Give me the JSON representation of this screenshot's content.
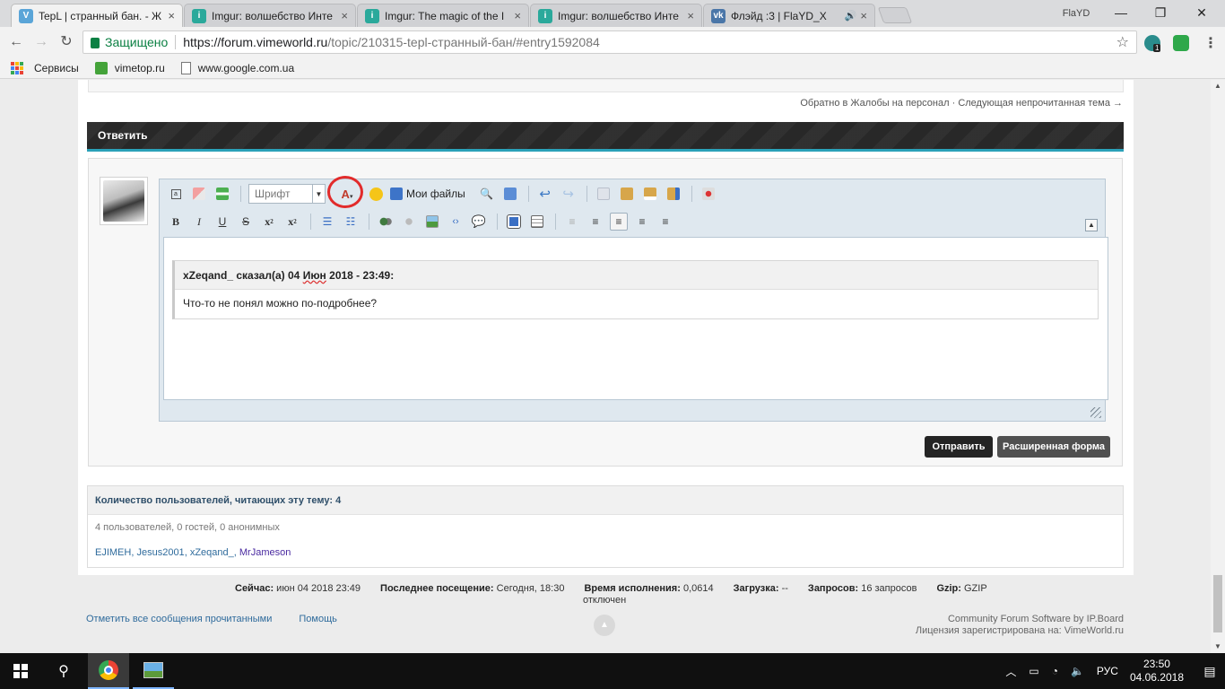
{
  "browser": {
    "tabs": [
      {
        "title": "TepL | странный бан. - Ж",
        "favicon": "vimeworld-icon",
        "active": true
      },
      {
        "title": "Imgur: волшебство Инте",
        "favicon": "imgur-icon",
        "active": false
      },
      {
        "title": "Imgur: The magic of the I",
        "favicon": "imgur-icon",
        "active": false
      },
      {
        "title": "Imgur: волшебство Инте",
        "favicon": "imgur-icon",
        "active": false
      },
      {
        "title": "Флэйд :3 | FlaYD_X",
        "favicon": "vk-icon",
        "active": false
      }
    ],
    "profile_name": "FlaYD",
    "secure_label": "Защищено",
    "url_base": "https://forum.vimeworld.ru",
    "url_rest": "/topic/210315-tepl-странный-бан/#entry1592084",
    "extension_badge": "1",
    "bookmarks": [
      {
        "label": "Сервисы",
        "icon": "apps-icon"
      },
      {
        "label": "vimetop.ru",
        "icon": "vimetop-icon"
      },
      {
        "label": "www.google.com.ua",
        "icon": "page-icon"
      }
    ]
  },
  "forum": {
    "nav": {
      "back_link": "Обратно в Жалобы на персонал",
      "separator": "·",
      "next_link": "Следующая непрочитанная тема →"
    },
    "reply": {
      "title": "Ответить",
      "font_select": "Шрифт",
      "my_files": "Мои файлы",
      "quote": {
        "author": "xZeqand_",
        "said": "сказал(а)",
        "day": "04",
        "month": "Июн",
        "rest": "2018 - 23:49:",
        "text": "Что-то не понял можно по-подробнее?"
      },
      "send_button": "Отправить",
      "advanced_button": "Расширенная форма"
    },
    "viewers": {
      "header": "Количество пользователей, читающих эту тему: 4",
      "count_text": "4 пользователей, 0 гостей, 0 анонимных",
      "users": [
        "EJIMEH",
        "Jesus2001",
        "xZeqand_",
        "MrJameson"
      ]
    },
    "stats": {
      "now_label": "Сейчас:",
      "now_value": "июн 04 2018 23:49",
      "last_label": "Последнее посещение:",
      "last_value": "Сегодня, 18:30",
      "exec_label": "Время исполнения:",
      "exec_value": "0,0614",
      "load_label": "Загрузка:",
      "load_value": "--",
      "queries_label": "Запросов:",
      "queries_value": "16 запросов",
      "gzip_label": "Gzip:",
      "gzip_value": "GZIP",
      "sub": "отключен"
    },
    "footer": {
      "mark_read": "Отметить все сообщения прочитанными",
      "help": "Помощь",
      "software": "Community Forum Software by IP.Board",
      "license": "Лицензия зарегистрирована на: VimeWorld.ru"
    }
  },
  "taskbar": {
    "language": "РУС",
    "time": "23:50",
    "date": "04.06.2018"
  }
}
